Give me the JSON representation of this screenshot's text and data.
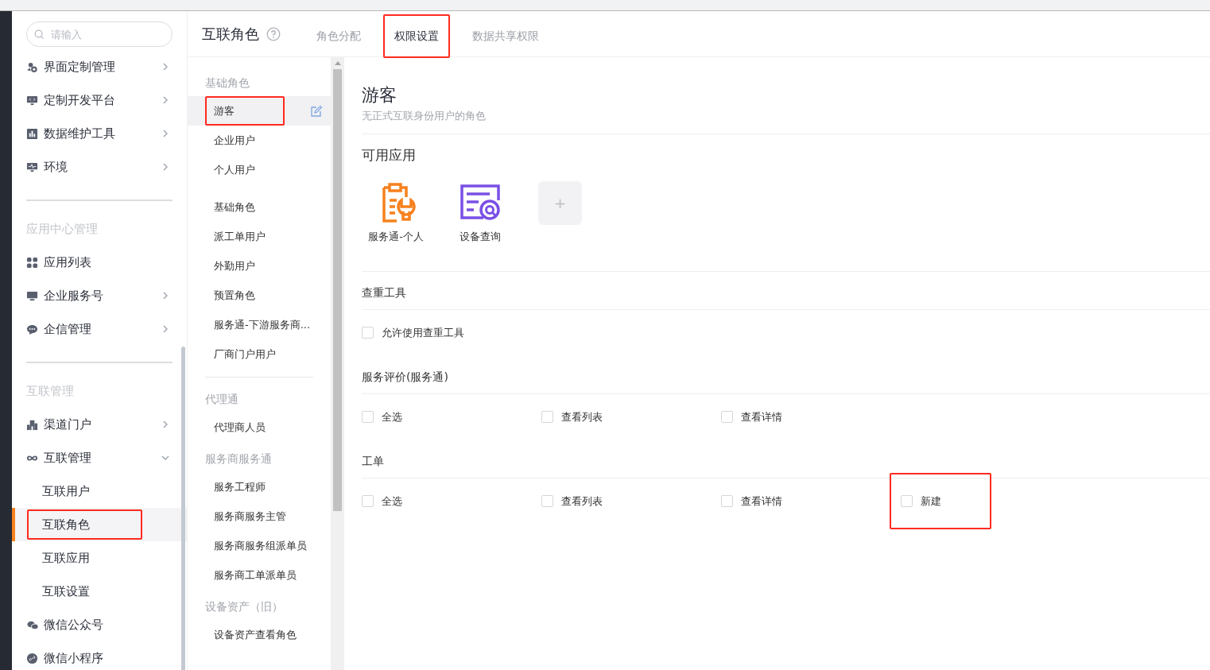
{
  "sidebar": {
    "search": {
      "placeholder": "请输入"
    },
    "sections": [
      {
        "items": [
          {
            "label": "界面定制管理",
            "expanded": false,
            "selected": false,
            "highlighted": false
          },
          {
            "label": "定制开发平台",
            "expanded": false,
            "selected": false,
            "highlighted": false
          },
          {
            "label": "数据维护工具",
            "expanded": false,
            "selected": false,
            "highlighted": false
          },
          {
            "label": "环境",
            "expanded": false,
            "selected": false,
            "highlighted": false
          }
        ]
      },
      {
        "title": "应用中心管理",
        "items": [
          {
            "label": "应用列表",
            "selected": false,
            "highlighted": false
          },
          {
            "label": "企业服务号",
            "expanded": false,
            "selected": false,
            "highlighted": false
          },
          {
            "label": "企信管理",
            "expanded": false,
            "selected": false,
            "highlighted": false
          }
        ]
      },
      {
        "title": "互联管理",
        "items": [
          {
            "label": "渠道门户",
            "expanded": false,
            "selected": false,
            "highlighted": false
          },
          {
            "label": "互联管理",
            "expanded": true,
            "selected": false,
            "highlighted": false,
            "children": [
              {
                "label": "互联用户",
                "selected": false,
                "highlighted": false
              },
              {
                "label": "互联角色",
                "selected": true,
                "highlighted": true
              },
              {
                "label": "互联应用",
                "selected": false,
                "highlighted": false
              },
              {
                "label": "互联设置",
                "selected": false,
                "highlighted": false
              }
            ]
          },
          {
            "label": "微信公众号",
            "selected": false,
            "highlighted": false
          },
          {
            "label": "微信小程序",
            "selected": false,
            "highlighted": false
          }
        ]
      }
    ]
  },
  "header": {
    "title": "互联角色",
    "tabs": [
      {
        "label": "角色分配",
        "selected": false,
        "highlighted": false
      },
      {
        "label": "权限设置",
        "selected": true,
        "highlighted": true
      },
      {
        "label": "数据共享权限",
        "selected": false,
        "highlighted": false
      }
    ]
  },
  "roles": [
    {
      "title": "基础角色",
      "items": [
        {
          "label": "游客",
          "selected": true,
          "highlighted": true
        },
        {
          "label": "企业用户",
          "selected": false,
          "highlighted": false
        },
        {
          "label": "个人用户",
          "selected": false,
          "highlighted": false
        }
      ]
    },
    {
      "items": [
        {
          "label": "基础角色",
          "selected": false,
          "highlighted": false
        },
        {
          "label": "派工单用户",
          "selected": false,
          "highlighted": false
        },
        {
          "label": "外勤用户",
          "selected": false,
          "highlighted": false
        },
        {
          "label": "预置角色",
          "selected": false,
          "highlighted": false
        },
        {
          "label": "服务通-下游服务商...",
          "selected": false,
          "highlighted": false
        },
        {
          "label": "厂商门户用户",
          "selected": false,
          "highlighted": false
        }
      ]
    },
    {
      "title": "代理通",
      "divider": true,
      "items": [
        {
          "label": "代理商人员",
          "selected": false,
          "highlighted": false
        }
      ]
    },
    {
      "title": "服务商服务通",
      "items": [
        {
          "label": "服务工程师",
          "selected": false,
          "highlighted": false
        },
        {
          "label": "服务商服务主管",
          "selected": false,
          "highlighted": false
        },
        {
          "label": "服务商服务组派单员",
          "selected": false,
          "highlighted": false
        },
        {
          "label": "服务商工单派单员",
          "selected": false,
          "highlighted": false
        }
      ]
    },
    {
      "title": "设备资产（旧）",
      "items": [
        {
          "label": "设备资产查看角色",
          "selected": false,
          "highlighted": false
        }
      ]
    }
  ],
  "detail": {
    "title": "游客",
    "subtitle": "无正式互联身份用户的角色",
    "apps": {
      "title": "可用应用",
      "items": [
        {
          "kind": "service",
          "label": "服务通-个人"
        },
        {
          "kind": "device",
          "label": "设备查询"
        },
        {
          "kind": "add",
          "label": "+"
        }
      ]
    },
    "sections": [
      {
        "title": "查重工具",
        "options": [
          {
            "label": "允许使用查重工具",
            "checked": false,
            "highlighted": false
          }
        ]
      },
      {
        "title": "服务评价(服务通)",
        "options": [
          {
            "label": "全选",
            "checked": false,
            "highlighted": false
          },
          {
            "label": "查看列表",
            "checked": false,
            "highlighted": false
          },
          {
            "label": "查看详情",
            "checked": false,
            "highlighted": false
          }
        ]
      },
      {
        "title": "工单",
        "options": [
          {
            "label": "全选",
            "checked": false,
            "highlighted": false
          },
          {
            "label": "查看列表",
            "checked": false,
            "highlighted": false
          },
          {
            "label": "查看详情",
            "checked": false,
            "highlighted": false
          },
          {
            "label": "新建",
            "checked": false,
            "highlighted": true
          }
        ]
      }
    ]
  }
}
